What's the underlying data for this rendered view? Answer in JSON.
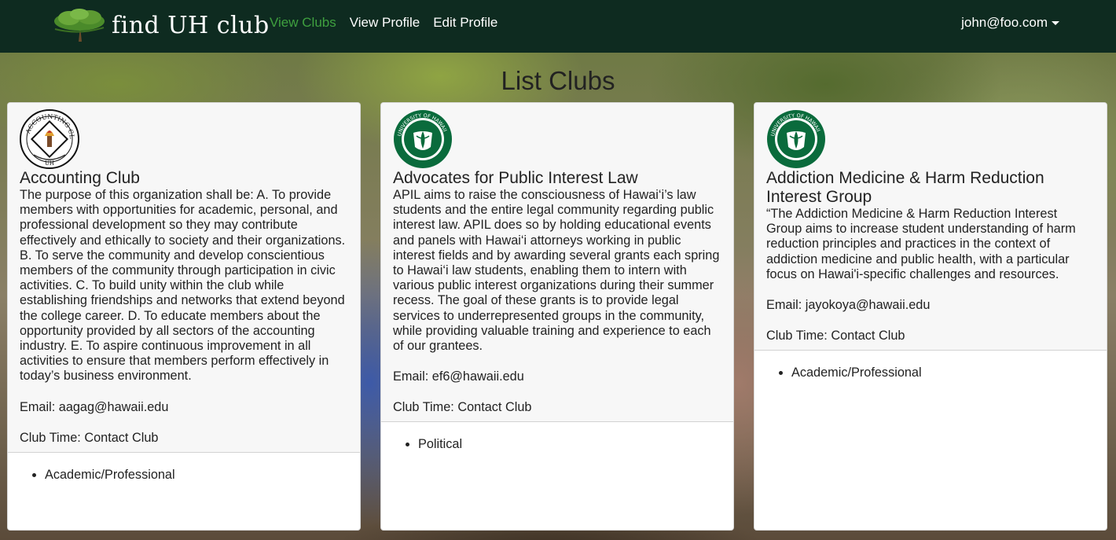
{
  "nav": {
    "brand": "find UH club",
    "links": [
      "View Clubs",
      "View Profile",
      "Edit Profile"
    ],
    "user": "john@foo.com"
  },
  "page": {
    "title": "List Clubs"
  },
  "clubs": [
    {
      "name": "Accounting Club",
      "logo": "accounting-club-seal",
      "description": "The purpose of this organization shall be: A. To provide members with opportunities for academic, personal, and professional development so they may contribute effectively and ethically to society and their organizations. B. To serve the community and develop conscientious members of the community through participation in civic activities. C. To build unity within the club while establishing friendships and networks that extend beyond the college career. D. To educate members about the opportunity provided by all sectors of the accounting industry. E. To aspire continuous improvement in all activities to ensure that members perform effectively in today’s business environment.",
      "email": "Email: aagag@hawaii.edu",
      "time": "Club Time: Contact Club",
      "tags": [
        "Academic/Professional"
      ]
    },
    {
      "name": "Advocates for Public Interest Law",
      "logo": "university-of-hawaii-seal",
      "description": "APIL aims to raise the consciousness of Hawai‘i’s law students and the entire legal community regarding public interest law. APIL does so by holding educational events and panels with Hawai‘i attorneys working in public interest fields and by awarding several grants each spring to Hawai‘i law students, enabling them to intern with various public interest organizations during their summer recess. The goal of these grants is to provide legal services to underrepresented groups in the community, while providing valuable training and experience to each of our grantees.",
      "email": "Email: ef6@hawaii.edu",
      "time": "Club Time: Contact Club",
      "tags": [
        "Political"
      ]
    },
    {
      "name": "Addiction Medicine & Harm Reduction Interest Group",
      "logo": "university-of-hawaii-seal",
      "description": "“The Addiction Medicine & Harm Reduction Interest Group aims to increase student understanding of harm reduction principles and practices in the context of addiction medicine and public health, with a particular focus on Hawai'i-specific challenges and resources.",
      "email": "Email: jayokoya@hawaii.edu",
      "time": "Club Time: Contact Club",
      "tags": [
        "Academic/Professional"
      ]
    }
  ],
  "logo_seals": {
    "accounting_top": "ACCOUNTING CLUB",
    "accounting_bottom": "UH",
    "uh_top": "UNIVERSITY OF HAWAII"
  },
  "colors": {
    "navbar": "#0e2b20",
    "active_link": "#3fa03f",
    "uh_green": "#0a6b3c"
  }
}
